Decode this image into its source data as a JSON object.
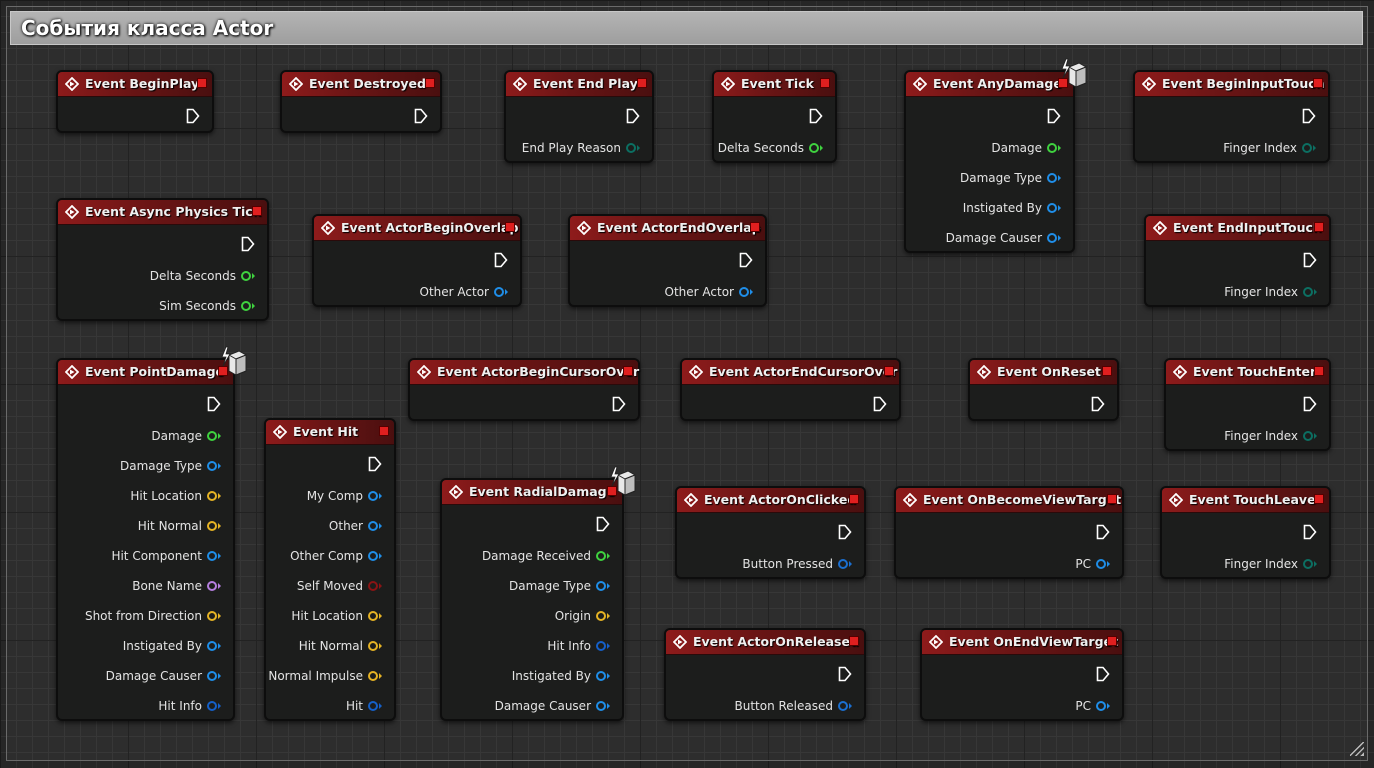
{
  "comment": {
    "title": "События класса Actor"
  },
  "colors": {
    "object": "#1f8ee8",
    "float": "#3fd23f",
    "vector": "#e6b324",
    "name": "#b67fe0",
    "bool": "#8a1414",
    "struct": "#1560c8",
    "enum": "#0c6f62",
    "key": "#1b6fd0",
    "delegate": "#e01f1f"
  },
  "nodes": [
    {
      "name": "event-begin-play",
      "title": "Event BeginPlay",
      "pins": []
    },
    {
      "name": "event-destroyed",
      "title": "Event Destroyed",
      "pins": []
    },
    {
      "name": "event-end-play",
      "title": "Event End Play",
      "pins": [
        {
          "label": "End Play Reason",
          "type": "enum"
        }
      ]
    },
    {
      "name": "event-tick",
      "title": "Event Tick",
      "pins": [
        {
          "label": "Delta Seconds",
          "type": "float"
        }
      ]
    },
    {
      "name": "event-any-damage",
      "title": "Event AnyDamage",
      "latent": true,
      "pins": [
        {
          "label": "Damage",
          "type": "float"
        },
        {
          "label": "Damage Type",
          "type": "object"
        },
        {
          "label": "Instigated By",
          "type": "object"
        },
        {
          "label": "Damage Causer",
          "type": "object"
        }
      ]
    },
    {
      "name": "event-begin-input-touch",
      "title": "Event BeginInputTouch",
      "pins": [
        {
          "label": "Finger Index",
          "type": "enum"
        }
      ]
    },
    {
      "name": "event-async-physics-tick",
      "title": "Event Async Physics Tick",
      "pins": [
        {
          "label": "Delta Seconds",
          "type": "float"
        },
        {
          "label": "Sim Seconds",
          "type": "float"
        }
      ]
    },
    {
      "name": "event-actor-begin-overlap",
      "title": "Event ActorBeginOverlap",
      "pins": [
        {
          "label": "Other Actor",
          "type": "object"
        }
      ]
    },
    {
      "name": "event-actor-end-overlap",
      "title": "Event ActorEndOverlap",
      "pins": [
        {
          "label": "Other Actor",
          "type": "object"
        }
      ]
    },
    {
      "name": "event-end-input-touch",
      "title": "Event EndInputTouch",
      "pins": [
        {
          "label": "Finger Index",
          "type": "enum"
        }
      ]
    },
    {
      "name": "event-point-damage",
      "title": "Event PointDamage",
      "latent": true,
      "pins": [
        {
          "label": "Damage",
          "type": "float"
        },
        {
          "label": "Damage Type",
          "type": "object"
        },
        {
          "label": "Hit Location",
          "type": "vector"
        },
        {
          "label": "Hit Normal",
          "type": "vector"
        },
        {
          "label": "Hit Component",
          "type": "object"
        },
        {
          "label": "Bone Name",
          "type": "name"
        },
        {
          "label": "Shot from Direction",
          "type": "vector"
        },
        {
          "label": "Instigated By",
          "type": "object"
        },
        {
          "label": "Damage Causer",
          "type": "object"
        },
        {
          "label": "Hit Info",
          "type": "struct"
        }
      ]
    },
    {
      "name": "event-hit",
      "title": "Event Hit",
      "pins": [
        {
          "label": "My Comp",
          "type": "object"
        },
        {
          "label": "Other",
          "type": "object"
        },
        {
          "label": "Other Comp",
          "type": "object"
        },
        {
          "label": "Self Moved",
          "type": "bool"
        },
        {
          "label": "Hit Location",
          "type": "vector"
        },
        {
          "label": "Hit Normal",
          "type": "vector"
        },
        {
          "label": "Normal Impulse",
          "type": "vector"
        },
        {
          "label": "Hit",
          "type": "struct"
        }
      ]
    },
    {
      "name": "event-actor-begin-cursor-over",
      "title": "Event ActorBeginCursorOver",
      "pins": []
    },
    {
      "name": "event-actor-end-cursor-over",
      "title": "Event ActorEndCursorOver",
      "pins": []
    },
    {
      "name": "event-on-reset",
      "title": "Event OnReset",
      "pins": []
    },
    {
      "name": "event-touch-enter",
      "title": "Event TouchEnter",
      "pins": [
        {
          "label": "Finger Index",
          "type": "enum"
        }
      ]
    },
    {
      "name": "event-radial-damage",
      "title": "Event RadialDamage",
      "latent": true,
      "pins": [
        {
          "label": "Damage Received",
          "type": "float"
        },
        {
          "label": "Damage Type",
          "type": "object"
        },
        {
          "label": "Origin",
          "type": "vector"
        },
        {
          "label": "Hit Info",
          "type": "struct"
        },
        {
          "label": "Instigated By",
          "type": "object"
        },
        {
          "label": "Damage Causer",
          "type": "object"
        }
      ]
    },
    {
      "name": "event-actor-on-clicked",
      "title": "Event ActorOnClicked",
      "pins": [
        {
          "label": "Button Pressed",
          "type": "key"
        }
      ]
    },
    {
      "name": "event-on-become-view-target",
      "title": "Event OnBecomeViewTarget",
      "pins": [
        {
          "label": "PC",
          "type": "object"
        }
      ]
    },
    {
      "name": "event-touch-leave",
      "title": "Event TouchLeave",
      "pins": [
        {
          "label": "Finger Index",
          "type": "enum"
        }
      ]
    },
    {
      "name": "event-actor-on-released",
      "title": "Event ActorOnReleased",
      "pins": [
        {
          "label": "Button Released",
          "type": "key"
        }
      ]
    },
    {
      "name": "event-on-end-view-target",
      "title": "Event OnEndViewTarget",
      "pins": [
        {
          "label": "PC",
          "type": "object"
        }
      ]
    }
  ]
}
